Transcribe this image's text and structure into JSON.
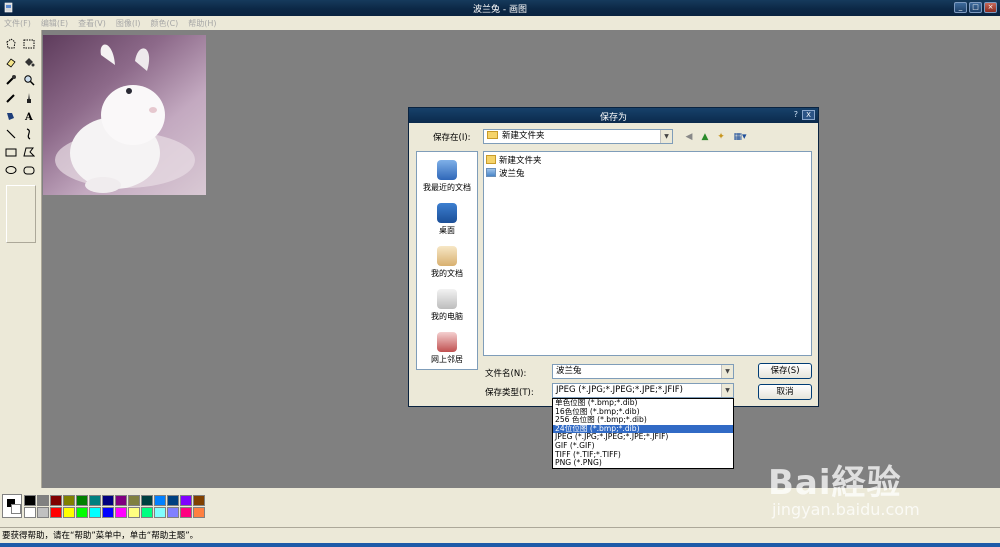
{
  "window": {
    "title": "波兰兔 - 画图"
  },
  "menu": [
    "文件(F)",
    "编辑(E)",
    "查看(V)",
    "图像(I)",
    "颜色(C)",
    "帮助(H)"
  ],
  "tools": [
    "free-select-icon",
    "rect-select-icon",
    "eraser-icon",
    "fill-bucket-icon",
    "color-picker-icon",
    "magnifier-icon",
    "pencil-icon",
    "brush-icon",
    "airbrush-icon",
    "text-icon",
    "line-icon",
    "curve-icon",
    "rectangle-icon",
    "polygon-icon",
    "ellipse-icon",
    "rounded-rect-icon"
  ],
  "palette": {
    "colors": [
      "#000000",
      "#808080",
      "#800000",
      "#808000",
      "#008000",
      "#008080",
      "#000080",
      "#800080",
      "#808040",
      "#004040",
      "#0080ff",
      "#004080",
      "#8000ff",
      "#804000",
      "#ffffff",
      "#c0c0c0",
      "#ff0000",
      "#ffff00",
      "#00ff00",
      "#00ffff",
      "#0000ff",
      "#ff00ff",
      "#ffff80",
      "#00ff80",
      "#80ffff",
      "#8080ff",
      "#ff0080",
      "#ff8040"
    ]
  },
  "status": "要获得帮助，请在“帮助”菜单中，单击“帮助主题”。",
  "dialog": {
    "title": "保存为",
    "help": "?",
    "close": "X",
    "save_in_label": "保存在(I):",
    "save_in_value": "新建文件夹",
    "places": [
      {
        "label": "我最近的文档",
        "icon": "recent-docs-icon"
      },
      {
        "label": "桌面",
        "icon": "desktop-icon"
      },
      {
        "label": "我的文档",
        "icon": "my-documents-icon"
      },
      {
        "label": "我的电脑",
        "icon": "my-computer-icon"
      },
      {
        "label": "网上邻居",
        "icon": "network-icon"
      }
    ],
    "files": [
      {
        "name": "新建文件夹",
        "icon": "folder-icon"
      },
      {
        "name": "波兰兔",
        "icon": "image-file-icon"
      }
    ],
    "filename_label": "文件名(N):",
    "filename_value": "波兰兔",
    "filetype_label": "保存类型(T):",
    "filetype_value": "JPEG (*.JPG;*.JPEG;*.JPE;*.JFIF)",
    "save_button": "保存(S)",
    "cancel_button": "取消",
    "filetype_options": [
      "单色位图 (*.bmp;*.dib)",
      "16色位图 (*.bmp;*.dib)",
      "256 色位图 (*.bmp;*.dib)",
      "24位位图 (*.bmp;*.dib)",
      "JPEG (*.JPG;*.JPEG;*.JPE;*.JFIF)",
      "GIF (*.GIF)",
      "TIFF (*.TIF;*.TIFF)",
      "PNG (*.PNG)"
    ],
    "selected_option_index": 3
  },
  "watermark": {
    "logo": "Bai経验",
    "sub": "jingyan.baidu.com"
  }
}
